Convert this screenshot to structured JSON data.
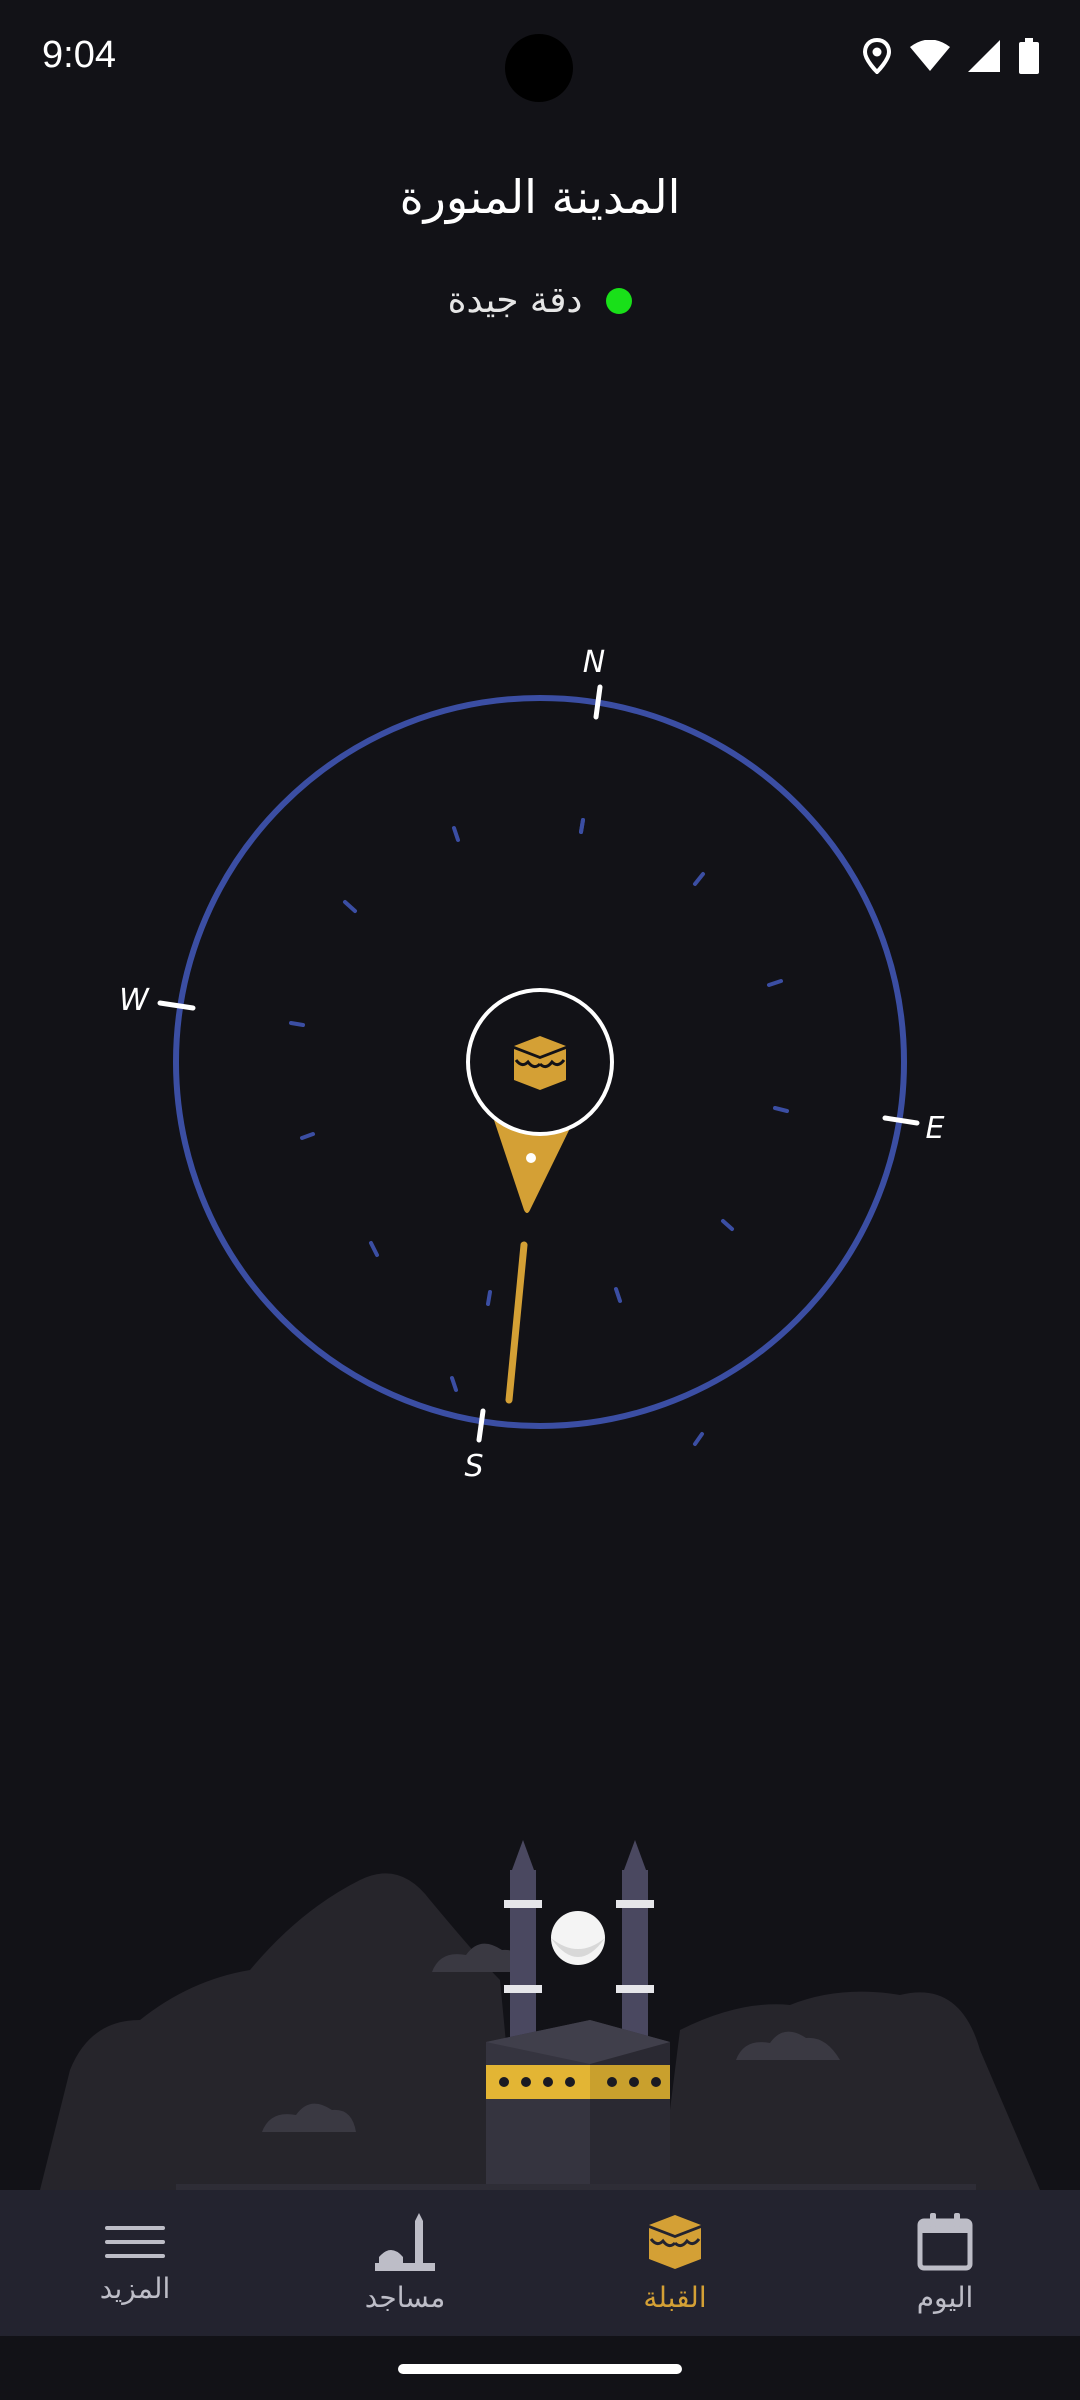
{
  "status_bar": {
    "time": "9:04",
    "icons": [
      "location-icon",
      "wifi-icon",
      "signal-icon",
      "battery-icon"
    ]
  },
  "header": {
    "city": "المدينة المنورة",
    "accuracy_text": "دقة جيدة",
    "accuracy_color": "#19e019"
  },
  "compass": {
    "labels": {
      "n": "N",
      "e": "E",
      "s": "S",
      "w": "W"
    },
    "ring_color": "#3b4ea3",
    "needle_color": "#d4a035"
  },
  "bottom_nav": {
    "items": [
      {
        "label": "المزيد",
        "icon": "menu-icon",
        "active": false
      },
      {
        "label": "مساجد",
        "icon": "mosque-icon",
        "active": false
      },
      {
        "label": "القبلة",
        "icon": "kaaba-icon",
        "active": true
      },
      {
        "label": "اليوم",
        "icon": "calendar-icon",
        "active": false
      }
    ],
    "active_color": "#d4a035"
  }
}
